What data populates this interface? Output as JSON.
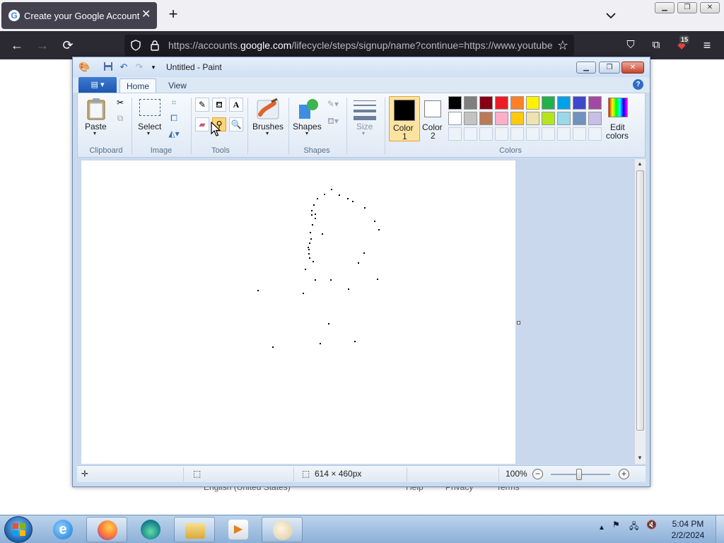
{
  "browser": {
    "tab_title": "Create your Google Account",
    "tab_favicon": "G",
    "url_prefix": "https://accounts.",
    "url_domain": "google.com",
    "url_suffix": "/lifecycle/steps/signup/name?continue=https://www.youtube",
    "extension_badge": "15"
  },
  "page": {
    "footer_language": "English (United States)",
    "footer_help": "Help",
    "footer_privacy": "Privacy",
    "footer_terms": "Terms"
  },
  "paint": {
    "title": "Untitled - Paint",
    "tabs": {
      "home": "Home",
      "view": "View"
    },
    "ribbon": {
      "paste": "Paste",
      "select": "Select",
      "brushes": "Brushes",
      "shapes": "Shapes",
      "size": "Size",
      "color1": "Color",
      "color1_num": "1",
      "color2": "Color",
      "color2_num": "2",
      "edit_colors": "Edit",
      "edit_colors_2": "colors",
      "groups": {
        "clipboard": "Clipboard",
        "image": "Image",
        "tools": "Tools",
        "shapes": "Shapes",
        "colors": "Colors"
      }
    },
    "palette_row1": [
      "#000000",
      "#7f7f7f",
      "#880015",
      "#ed1c24",
      "#ff7f27",
      "#fff200",
      "#22b14c",
      "#00a2e8",
      "#3f48cc",
      "#a349a4"
    ],
    "palette_row2": [
      "#ffffff",
      "#c3c3c3",
      "#b97a57",
      "#ffaec9",
      "#ffc90e",
      "#efe4b0",
      "#b5e61d",
      "#99d9ea",
      "#7092be",
      "#c8bfe7"
    ],
    "status": {
      "canvas_size": "614 × 460px",
      "zoom": "100%"
    }
  },
  "taskbar": {
    "time": "5:04 PM",
    "date": "2/2/2024"
  }
}
